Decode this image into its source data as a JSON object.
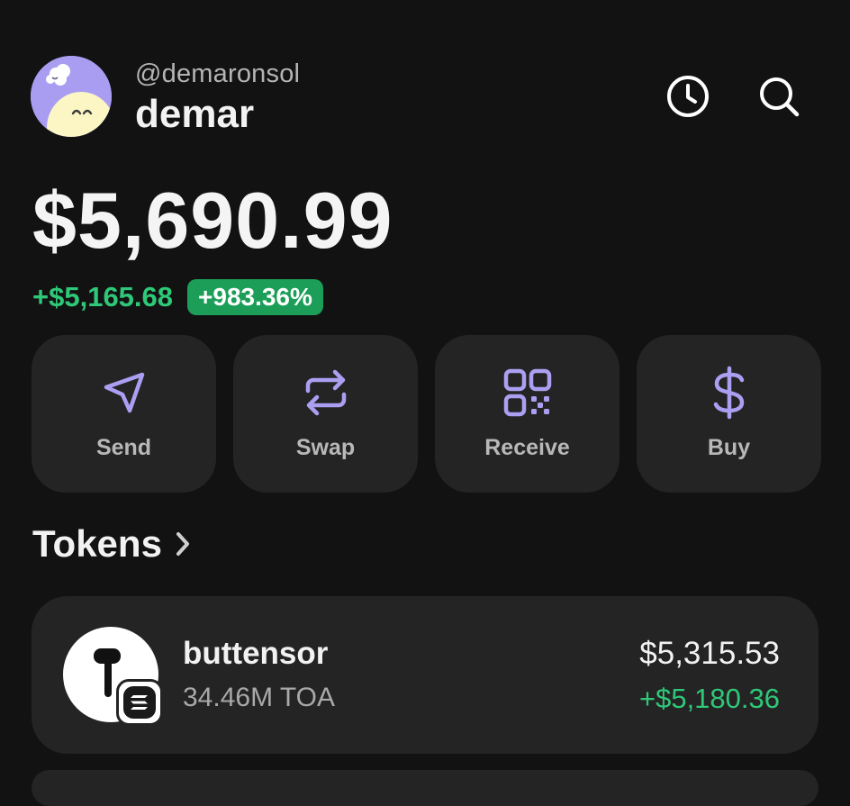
{
  "profile": {
    "handle": "@demaronsol",
    "username": "demar",
    "avatar_icon": "sleepy-ghost-avatar-icon",
    "avatar_color": "#a99df2"
  },
  "header_icons": {
    "history": "clock-icon",
    "search": "search-icon"
  },
  "balance": {
    "total": "$5,690.99",
    "change_amount": "+$5,165.68",
    "change_percent": "+983.36%"
  },
  "actions": [
    {
      "label": "Send",
      "icon": "paper-plane-icon"
    },
    {
      "label": "Swap",
      "icon": "swap-arrows-icon"
    },
    {
      "label": "Receive",
      "icon": "qr-code-icon"
    },
    {
      "label": "Buy",
      "icon": "dollar-icon"
    }
  ],
  "tokens": {
    "heading": "Tokens",
    "items": [
      {
        "name": "buttensor",
        "amount": "34.46M TOA",
        "value": "$5,315.53",
        "change": "+$5,180.36",
        "icon": "earbud-icon",
        "chain_icon": "solana-icon"
      }
    ]
  },
  "colors": {
    "background": "#121212",
    "card": "#242424",
    "accent_purple": "#ab9ff2",
    "positive_green": "#2ec878",
    "badge_green": "#1c9e58"
  }
}
